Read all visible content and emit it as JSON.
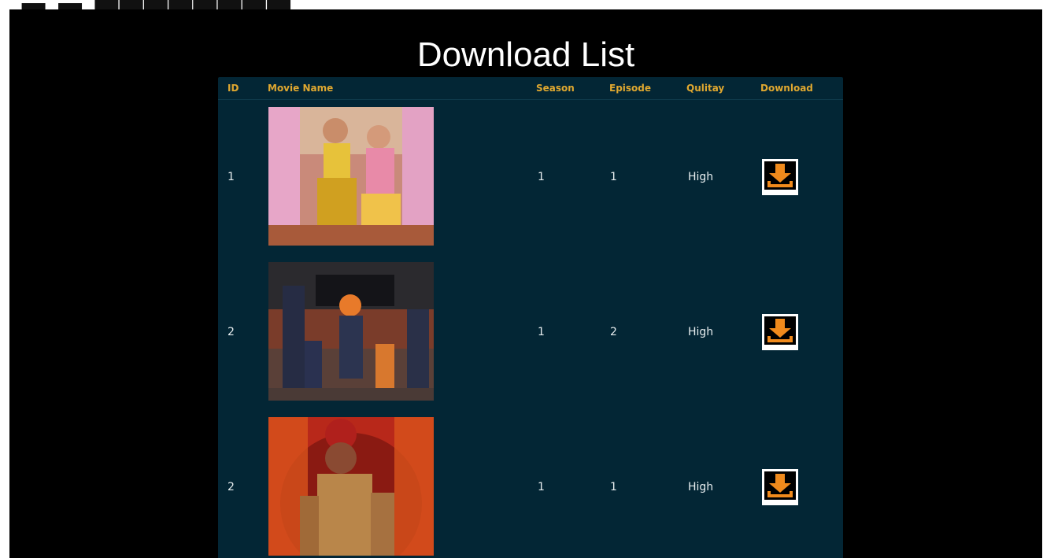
{
  "page": {
    "title": "Download List"
  },
  "table": {
    "columns": {
      "id": "ID",
      "name": "Movie Name",
      "season": "Season",
      "episode": "Episode",
      "quality": "Qulitay",
      "download": "Download"
    },
    "rows": [
      {
        "id": "1",
        "season": "1",
        "episode": "1",
        "quality": "High"
      },
      {
        "id": "2",
        "season": "1",
        "episode": "2",
        "quality": "High"
      },
      {
        "id": "2",
        "season": "1",
        "episode": "1",
        "quality": "High"
      }
    ]
  },
  "icons": {
    "download": "download-icon"
  },
  "colors": {
    "panel_bg": "#032635",
    "header_text": "#e0a830",
    "accent_orange": "#f08a1c",
    "page_bg": "#000000"
  }
}
